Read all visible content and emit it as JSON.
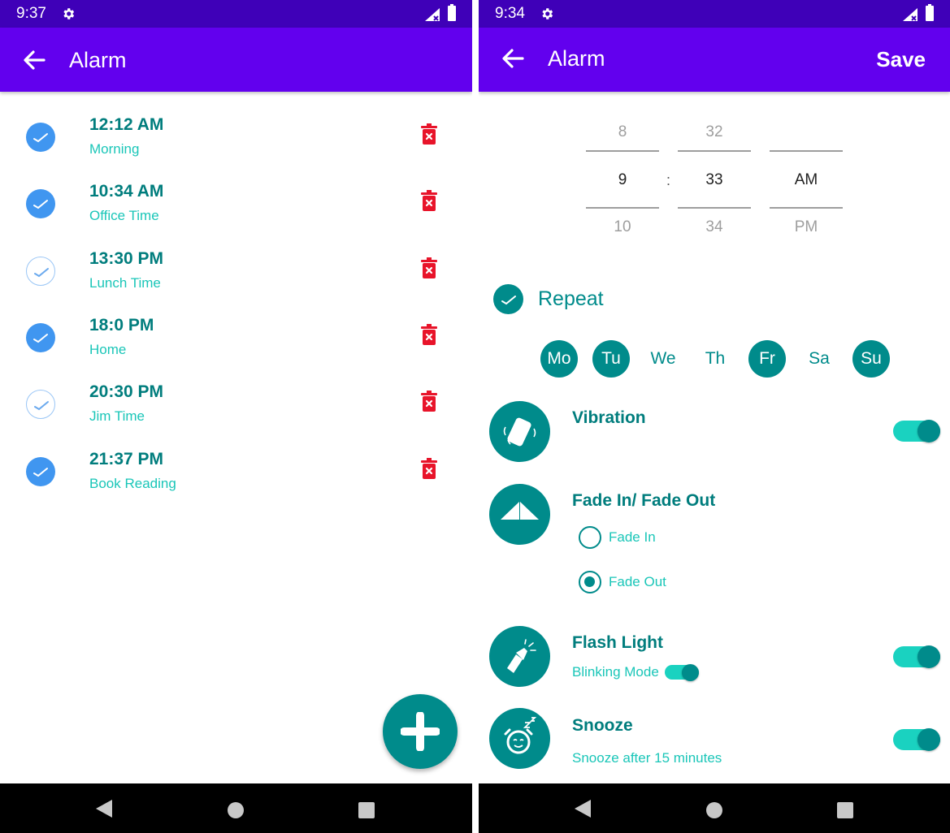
{
  "left": {
    "status": {
      "time": "9:37"
    },
    "appbar": {
      "title": "Alarm"
    },
    "alarms": [
      {
        "time": "12:12 AM",
        "label": "Morning",
        "enabled": true
      },
      {
        "time": "10:34 AM",
        "label": "Office Time",
        "enabled": true
      },
      {
        "time": "13:30 PM",
        "label": "Lunch Time",
        "enabled": false
      },
      {
        "time": "18:0 PM",
        "label": "Home",
        "enabled": true
      },
      {
        "time": "20:30 PM",
        "label": "Jim Time",
        "enabled": false
      },
      {
        "time": "21:37 PM",
        "label": "Book Reading",
        "enabled": true
      }
    ],
    "fab": {
      "icon": "plus-icon"
    }
  },
  "right": {
    "status": {
      "time": "9:34"
    },
    "appbar": {
      "title": "Alarm",
      "save_label": "Save"
    },
    "picker": {
      "hour": {
        "prev": "8",
        "current": "9",
        "next": "10"
      },
      "separator": ":",
      "minute": {
        "prev": "32",
        "current": "33",
        "next": "34"
      },
      "ampm": {
        "prev": "",
        "current": "AM",
        "next": "PM"
      }
    },
    "repeat": {
      "label": "Repeat",
      "checked": true,
      "days": [
        {
          "label": "Mo",
          "selected": true
        },
        {
          "label": "Tu",
          "selected": true
        },
        {
          "label": "We",
          "selected": false
        },
        {
          "label": "Th",
          "selected": false
        },
        {
          "label": "Fr",
          "selected": true
        },
        {
          "label": "Sa",
          "selected": false
        },
        {
          "label": "Su",
          "selected": true
        }
      ]
    },
    "vibration": {
      "title": "Vibration",
      "enabled": true,
      "icon": "vibration-icon"
    },
    "fade": {
      "title": "Fade In/ Fade Out",
      "icon": "fade-icon",
      "options": [
        "Fade In",
        "Fade Out"
      ],
      "selected": "Fade Out"
    },
    "flash": {
      "title": "Flash Light",
      "subtitle": "Blinking Mode",
      "enabled": true,
      "blinking": true,
      "icon": "flashlight-icon"
    },
    "snooze": {
      "title": "Snooze",
      "subtitle": "Snooze after 15 minutes",
      "enabled": true,
      "icon": "snooze-alarm-icon"
    }
  },
  "colors": {
    "statusbar": "#3f00b8",
    "appbar": "#6200ee",
    "teal": "#008b8b",
    "teal_light": "#1ac6b8",
    "check_blue": "#4096f0",
    "delete_red": "#e8142a"
  }
}
